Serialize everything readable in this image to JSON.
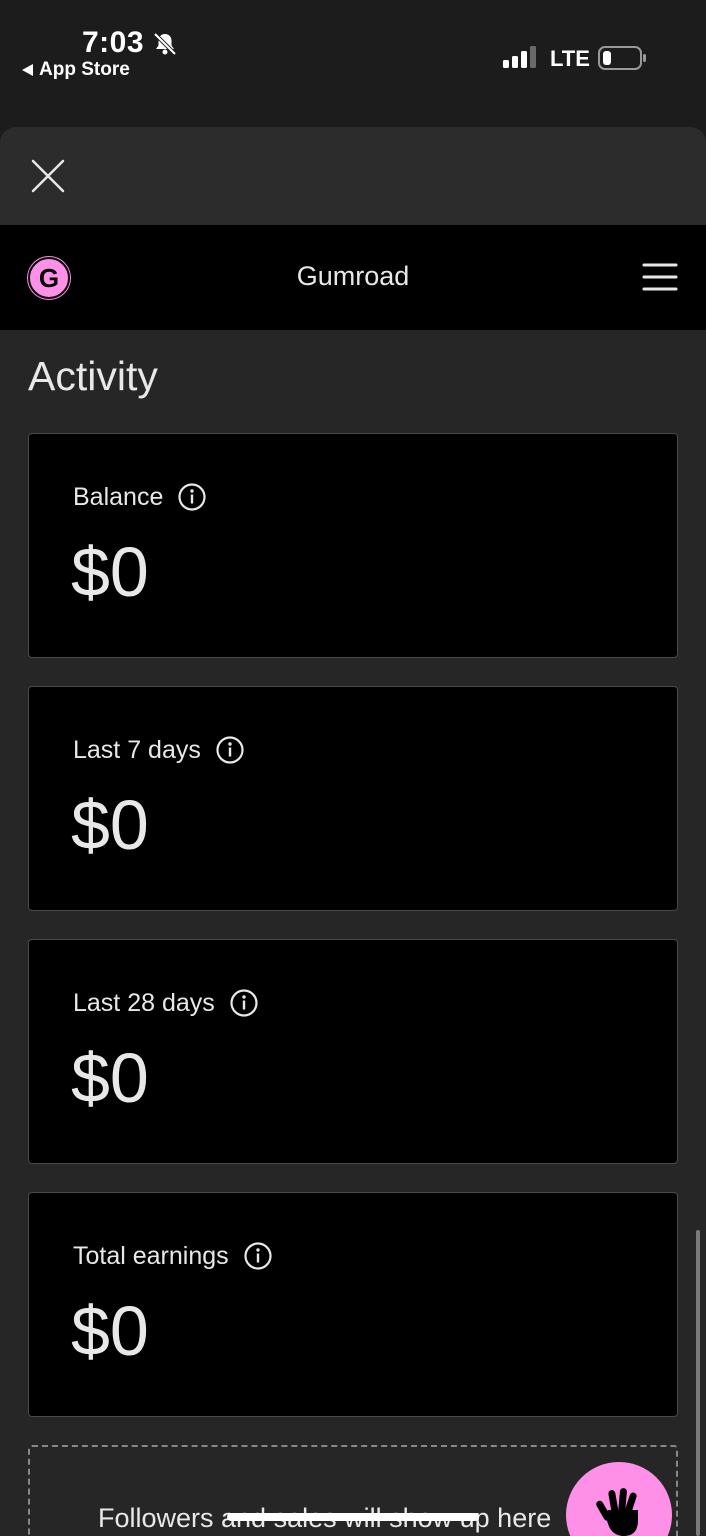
{
  "status_bar": {
    "time": "7:03",
    "back_label": "App Store",
    "network": "LTE"
  },
  "nav": {
    "logo_letter": "G",
    "title": "Gumroad"
  },
  "page": {
    "title": "Activity"
  },
  "cards": [
    {
      "label": "Balance",
      "value": "$0"
    },
    {
      "label": "Last 7 days",
      "value": "$0"
    },
    {
      "label": "Last 28 days",
      "value": "$0"
    },
    {
      "label": "Total earnings",
      "value": "$0"
    }
  ],
  "empty_state": {
    "text": "Followers and sales will show up here"
  },
  "colors": {
    "brand_pink": "#ff90e8",
    "card_bg": "#000000",
    "sheet_bg": "#262626"
  },
  "icons": [
    "bell-slash-icon",
    "signal-icon",
    "battery-icon",
    "close-icon",
    "menu-icon",
    "info-icon",
    "hand-icon"
  ]
}
